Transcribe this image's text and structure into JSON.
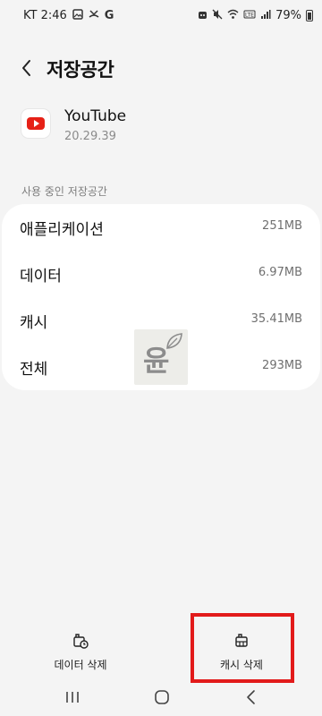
{
  "status_bar": {
    "carrier_time": "KT 2:46",
    "left_icons": [
      "gallery-icon",
      "missed-call-icon",
      "google-icon"
    ],
    "g_letter": "G",
    "battery": "79%"
  },
  "header": {
    "title": "저장공간"
  },
  "app": {
    "name": "YouTube",
    "version": "20.29.39"
  },
  "storage": {
    "section_label": "사용 중인 저장공간",
    "rows": [
      {
        "label": "애플리케이션",
        "value": "251MB"
      },
      {
        "label": "데이터",
        "value": "6.97MB"
      },
      {
        "label": "캐시",
        "value": "35.41MB"
      },
      {
        "label": "전체",
        "value": "293MB"
      }
    ]
  },
  "watermark": {
    "text": "윤"
  },
  "actions": {
    "clear_data": "데이터 삭제",
    "clear_cache": "캐시 삭제"
  },
  "colors": {
    "background": "#f4f4f4",
    "card": "#ffffff",
    "youtube_red": "#e62117",
    "highlight": "#e21a1a"
  }
}
